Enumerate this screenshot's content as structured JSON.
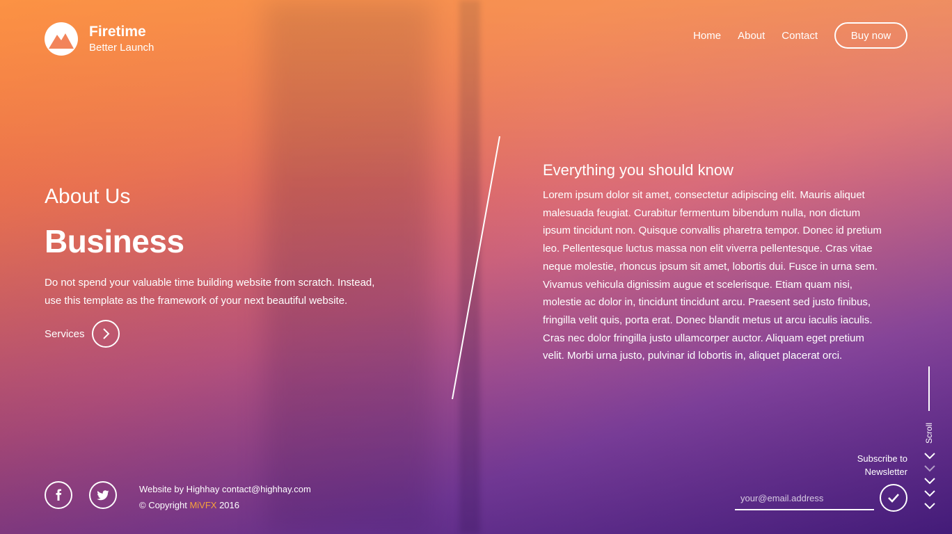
{
  "brand": {
    "title": "Firetime",
    "subtitle": "Better Launch",
    "icon": "mountain-logo-icon"
  },
  "nav": {
    "items": [
      "Home",
      "About",
      "Contact"
    ],
    "buy_label": "Buy now"
  },
  "hero": {
    "label": "About Us",
    "title": "Business",
    "intro": "Do not spend your valuable time building website from scratch. Instead, use this template as the framework of your next beautiful website.",
    "services_label": "Services"
  },
  "info": {
    "title": "Everything you should know",
    "body": "Lorem ipsum dolor sit amet, consectetur adipiscing elit. Mauris aliquet malesuada feugiat. Curabitur fermentum bibendum nulla, non dictum ipsum tincidunt non. Quisque convallis pharetra tempor. Donec id pretium leo. Pellentesque luctus massa non elit viverra pellentesque. Cras vitae neque molestie, rhoncus ipsum sit amet, lobortis dui. Fusce in urna sem. Vivamus vehicula dignissim augue et scelerisque. Etiam quam nisi, molestie ac dolor in, tincidunt tincidunt arcu. Praesent sed justo finibus, fringilla velit quis, porta erat. Donec blandit metus ut arcu iaculis iaculis. Cras nec dolor fringilla justo ullamcorper auctor. Aliquam eget pretium velit. Morbi urna justo, pulvinar id lobortis in, aliquet placerat orci."
  },
  "footer": {
    "line1": "Website by Highhay contact@highhay.com",
    "copyright_prefix": "© Copyright ",
    "copyright_brand": "MiVFX",
    "copyright_year": " 2016",
    "social": [
      "facebook-icon",
      "twitter-icon"
    ]
  },
  "newsletter": {
    "label_line1": "Subscribe to",
    "label_line2": "Newsletter",
    "placeholder": "your@email.address"
  },
  "scroll": {
    "label": "Scroll"
  },
  "colors": {
    "accent": "#f7a23a",
    "gradient_top": "#ff7828",
    "gradient_bottom": "#3c146e"
  }
}
